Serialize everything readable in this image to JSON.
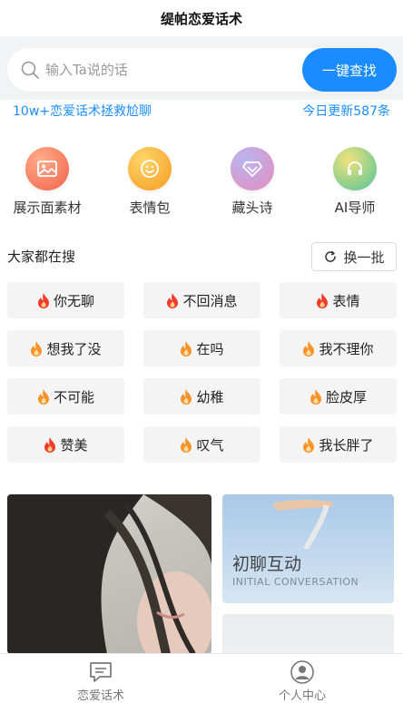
{
  "app": {
    "title": "缇帕恋爱话术"
  },
  "search": {
    "placeholder": "输入Ta说的话",
    "button_label": "一键查找"
  },
  "promo": {
    "left_text": "10w+恋爱话术拯救尬聊",
    "right_text": "今日更新587条"
  },
  "features": [
    {
      "label": "展示面素材",
      "icon": "image-icon",
      "color": "#f47b5c"
    },
    {
      "label": "表情包",
      "icon": "smiley-icon",
      "color": "#f5a623"
    },
    {
      "label": "藏头诗",
      "icon": "diamond-icon",
      "color": "#d58fc4"
    },
    {
      "label": "AI导师",
      "icon": "headset-icon",
      "color": "#6cc98a"
    }
  ],
  "hot": {
    "title": "大家都在搜",
    "refresh_label": "换一批",
    "tags": [
      {
        "label": "你无聊",
        "flame": "red"
      },
      {
        "label": "不回消息",
        "flame": "red"
      },
      {
        "label": "表情",
        "flame": "red"
      },
      {
        "label": "想我了没",
        "flame": "orange"
      },
      {
        "label": "在吗",
        "flame": "orange"
      },
      {
        "label": "我不理你",
        "flame": "orange"
      },
      {
        "label": "不可能",
        "flame": "orange"
      },
      {
        "label": "幼稚",
        "flame": "orange"
      },
      {
        "label": "脸皮厚",
        "flame": "orange"
      },
      {
        "label": "赞美",
        "flame": "red"
      },
      {
        "label": "叹气",
        "flame": "orange"
      },
      {
        "label": "我长胖了",
        "flame": "orange"
      }
    ]
  },
  "cards": {
    "right_top_title": "初聊互动",
    "right_top_subtitle": "INITIAL CONVERSATION"
  },
  "tabbar": [
    {
      "label": "恋爱话术",
      "icon": "chat-icon"
    },
    {
      "label": "个人中心",
      "icon": "user-icon"
    }
  ],
  "colors": {
    "accent": "#1a8cff",
    "flame_red": "#f23b2a",
    "flame_orange": "#f79327"
  }
}
